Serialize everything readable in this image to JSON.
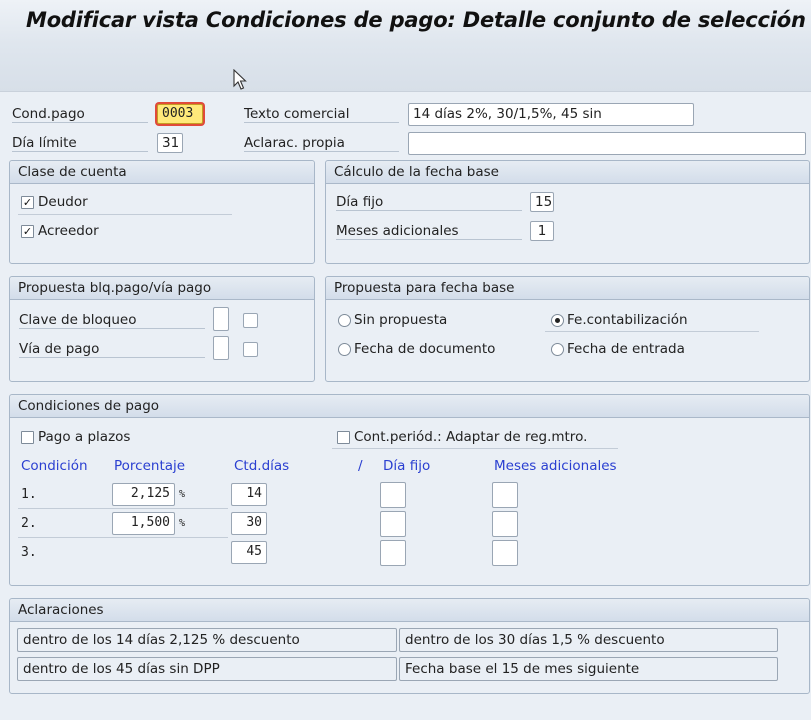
{
  "window": {
    "title": "Modificar vista Condiciones de pago: Detalle conjunto de selección"
  },
  "header": {
    "cond_pago_label": "Cond.pago",
    "cond_pago_value": "0003",
    "texto_comercial_label": "Texto comercial",
    "texto_comercial_value": "14 días 2%, 30/1,5%, 45 sin",
    "dia_limite_label": "Día límite",
    "dia_limite_value": "31",
    "aclarac_label": "Aclarac. propia",
    "aclarac_value": ""
  },
  "clase_cuenta": {
    "title": "Clase de cuenta",
    "deudor": {
      "label": "Deudor",
      "checked": true
    },
    "acreedor": {
      "label": "Acreedor",
      "checked": true
    }
  },
  "calculo_fecha": {
    "title": "Cálculo de la fecha base",
    "dia_fijo_label": "Día fijo",
    "dia_fijo_value": "15",
    "meses_label": "Meses adicionales",
    "meses_value": "1"
  },
  "propuesta_blq": {
    "title": "Propuesta blq.pago/vía pago",
    "clave_label": "Clave de bloqueo",
    "via_label": "Vía de pago"
  },
  "propuesta_fecha": {
    "title": "Propuesta para fecha base",
    "options": [
      {
        "label": "Sin propuesta",
        "selected": false
      },
      {
        "label": "Fe.contabilización",
        "selected": true
      },
      {
        "label": "Fecha de documento",
        "selected": false
      },
      {
        "label": "Fecha de entrada",
        "selected": false
      }
    ]
  },
  "condiciones": {
    "title": "Condiciones de pago",
    "pago_plazos_label": "Pago a plazos",
    "cont_periodica_label": "Cont.periód.: Adaptar de reg.mtro.",
    "headers": {
      "condicion": "Condición",
      "porcentaje": "Porcentaje",
      "ctd_dias": "Ctd.días",
      "slash": "/",
      "dia_fijo": "Día fijo",
      "meses": "Meses adicionales"
    },
    "pct_sign": "%",
    "rows": [
      {
        "num": "1.",
        "pct": "2,125",
        "dias": "14"
      },
      {
        "num": "2.",
        "pct": "1,500",
        "dias": "30"
      },
      {
        "num": "3.",
        "pct": "",
        "dias": "45"
      }
    ]
  },
  "aclaraciones": {
    "title": "Aclaraciones",
    "notes": [
      "dentro de los 14 días 2,125 % descuento",
      "dentro de los 30 días 1,5 % descuento",
      "dentro de los 45 días sin DPP",
      "Fecha base el 15 de mes siguiente"
    ]
  },
  "colors": {
    "accent_blue": "#2a3fd1",
    "highlight": "#ffe97a",
    "highlight_border": "#e04a3a"
  },
  "icons": {
    "pointer": "mouse-cursor-icon"
  }
}
